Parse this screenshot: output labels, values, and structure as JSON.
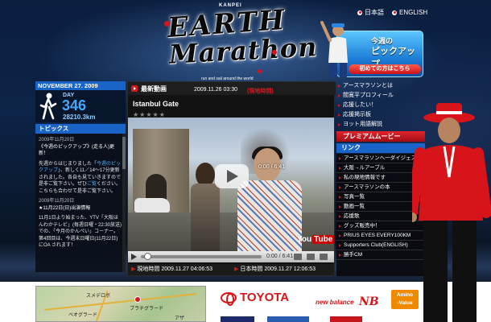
{
  "lang": {
    "ja": "日本語",
    "en": "ENGLISH"
  },
  "logo": {
    "brand": "KANPEI",
    "line1": "EARTH",
    "line2": "Marathon",
    "tagline": "run and sail around the world"
  },
  "pickup": {
    "line1": "今週の",
    "line2": "ピックアップ",
    "button": "初めての方はこちら"
  },
  "status": {
    "date": "NOVEMBER 27. 2009",
    "day_label": "DAY",
    "day_number": "346",
    "distance": "28210.3km"
  },
  "topics": {
    "heading": "トピックス",
    "items": [
      {
        "date": "2009年11月20日",
        "title": "《今週のピックアップ》(走る人)更新！",
        "body_a": "先週からはじまりました「",
        "link": "今週のピックアップ",
        "body_b": "」、新しく11／14〜17分更新されました。各自も見ていきますので是非ご覧下さい。ぜひ",
        "link2": "ご覧",
        "body_c": "ください。こちらも合わせて是非ご覧下さい。"
      },
      {
        "date": "2009年11月20日",
        "title": "★11月22日(日)出演情報",
        "body_a": "11月1日より始まった、YTV「大阪ほんわかテレビ」(毎週日曜・22:30放送)での、「今月のかんぺい」コーナー。第4回目は、今週末日曜日(11月22日)にOA されます！",
        "link": "",
        "body_b": "",
        "link2": "",
        "body_c": ""
      }
    ]
  },
  "video": {
    "section": "最新動画",
    "timestamp": "2009.11.26 03:30",
    "timestamp_label": "(現地時間)",
    "title": "Istanbul Gate",
    "rating": "★★★★★",
    "time_overlay": "0:00 / 6:41",
    "control_time": "0:00 / 6:41",
    "youtube_a": "You",
    "youtube_b": "Tube",
    "local_label": "現地時間",
    "local_time": "2009.11.27 04:06:53",
    "japan_label": "日本時間",
    "japan_time": "2009.11.27 12:06:53"
  },
  "menu": {
    "items": [
      "アースマラソンとは",
      "間寛平プロフィール",
      "応援したい！",
      "応援掲示板",
      "ヨット用語解説"
    ],
    "premium": "プレミアムムービー",
    "link_heading": "リンク",
    "links": [
      "アースマラソンへ一ダイジェストVTR",
      "大阪→ルアーブル",
      "私の現地情報です",
      "アースマラソンの本",
      "写真一覧",
      "動画一覧",
      "応援歌",
      "グッズ販売中！",
      "PRIUS EYES EVERY100KM",
      "Supporters Club(ENGLISH)",
      "勝手CM"
    ]
  },
  "map": {
    "labels": [
      "スメデロボ",
      "ブラチグラード",
      "ベオグラード",
      "アザ"
    ]
  },
  "sponsors": {
    "toyota": "TOYOTA",
    "nb": "new balance",
    "nbmark": "NB",
    "amino_a": "Amino",
    "amino_b": "-Value"
  },
  "colors": {
    "accent_blue": "#1a63c7",
    "accent_red": "#d41820",
    "day_number": "#42a9ff"
  }
}
